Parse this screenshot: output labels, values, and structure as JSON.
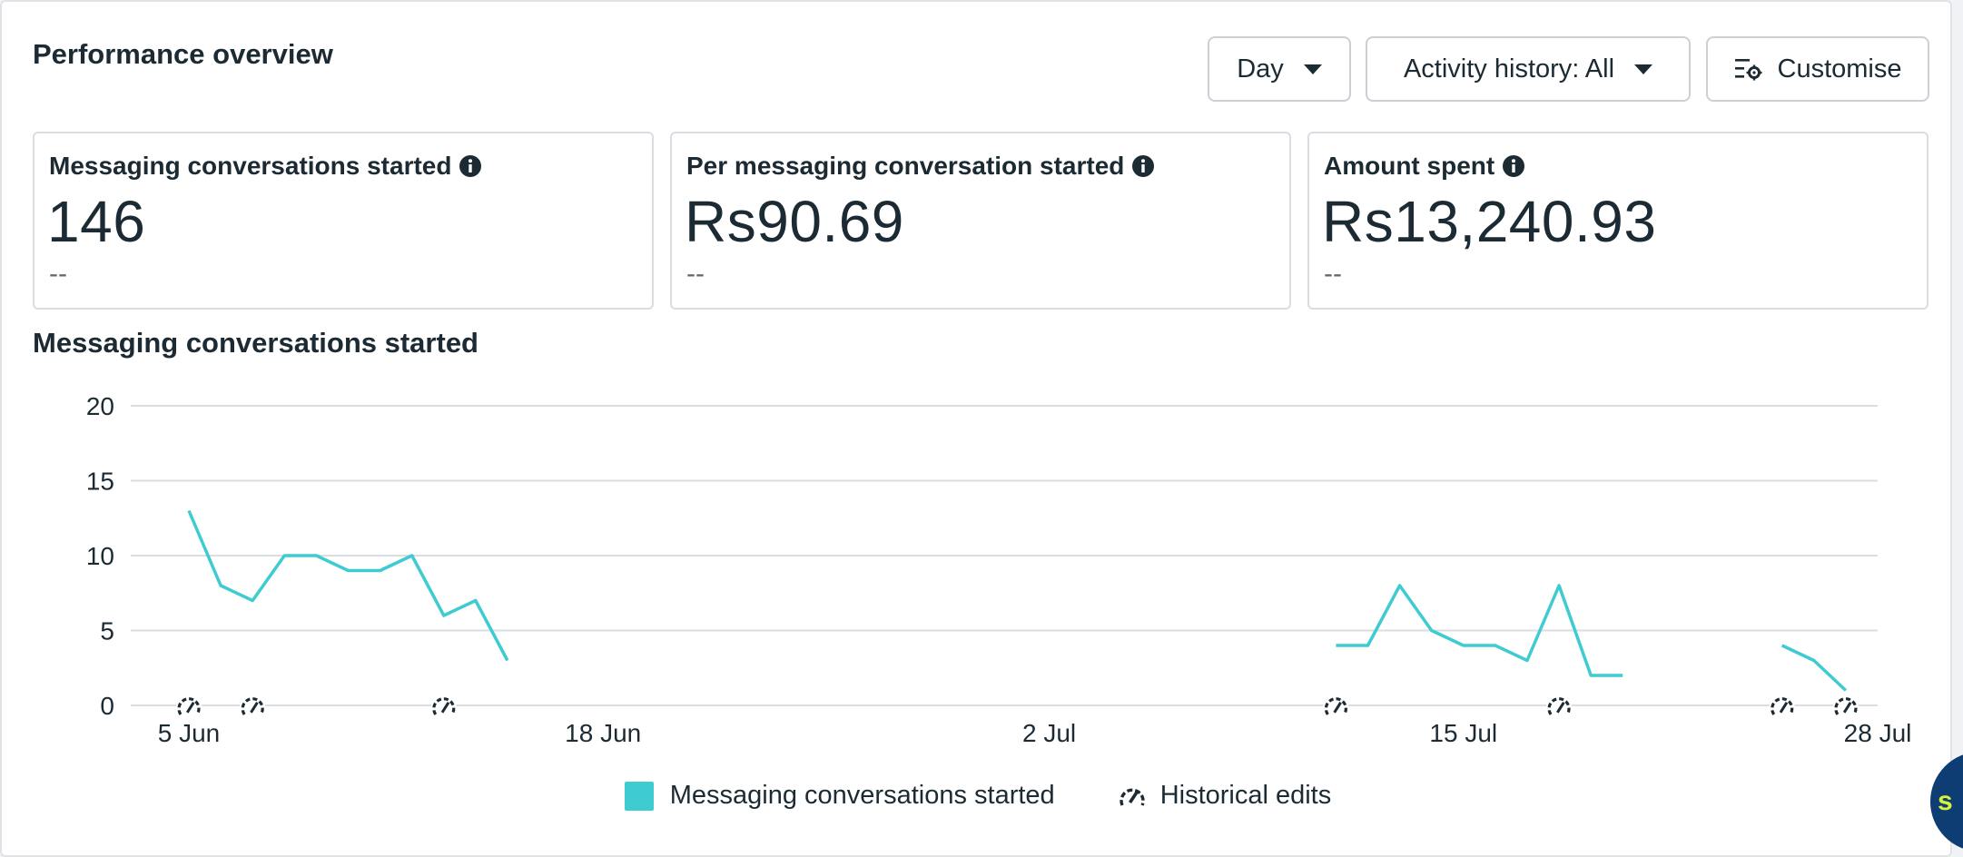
{
  "header": {
    "title": "Performance overview",
    "day_label": "Day",
    "activity_label": "Activity history: All",
    "customise_label": "Customise"
  },
  "kpis": [
    {
      "label": "Messaging conversations started",
      "value": "146",
      "compare": "--"
    },
    {
      "label": "Per messaging conversation started",
      "value": "Rs90.69",
      "compare": "--"
    },
    {
      "label": "Amount spent",
      "value": "Rs13,240.93",
      "compare": "--"
    }
  ],
  "chart_title": "Messaging conversations started",
  "colors": {
    "series": "#3ecbd2",
    "grid": "#dadde1",
    "text": "#1c2b33"
  },
  "chart_data": {
    "type": "line",
    "title": "Messaging conversations started",
    "xlabel": "",
    "ylabel": "",
    "ylim": [
      0,
      20
    ],
    "y_ticks": [
      0,
      5,
      10,
      15,
      20
    ],
    "x_range": [
      "2024-06-05",
      "2024-07-28"
    ],
    "x_tick_labels": [
      {
        "date": "2024-06-05",
        "label": "5 Jun"
      },
      {
        "date": "2024-06-18",
        "label": "18 Jun"
      },
      {
        "date": "2024-07-02",
        "label": "2 Jul"
      },
      {
        "date": "2024-07-15",
        "label": "15 Jul"
      },
      {
        "date": "2024-07-28",
        "label": "28 Jul"
      }
    ],
    "grid": true,
    "legend_position": "bottom-center",
    "series": [
      {
        "name": "Messaging conversations started",
        "segments": [
          [
            [
              "2024-06-05",
              13
            ],
            [
              "2024-06-06",
              8
            ],
            [
              "2024-06-07",
              7
            ],
            [
              "2024-06-08",
              10
            ],
            [
              "2024-06-09",
              10
            ],
            [
              "2024-06-10",
              9
            ],
            [
              "2024-06-11",
              9
            ],
            [
              "2024-06-12",
              10
            ],
            [
              "2024-06-13",
              6
            ],
            [
              "2024-06-14",
              7
            ],
            [
              "2024-06-15",
              3
            ]
          ],
          [
            [
              "2024-07-11",
              4
            ],
            [
              "2024-07-12",
              4
            ],
            [
              "2024-07-13",
              8
            ],
            [
              "2024-07-14",
              5
            ],
            [
              "2024-07-15",
              4
            ],
            [
              "2024-07-16",
              4
            ],
            [
              "2024-07-17",
              3
            ],
            [
              "2024-07-18",
              8
            ],
            [
              "2024-07-19",
              2
            ],
            [
              "2024-07-20",
              2
            ]
          ],
          [
            [
              "2024-07-25",
              4
            ],
            [
              "2024-07-26",
              3
            ],
            [
              "2024-07-27",
              1
            ]
          ]
        ]
      }
    ],
    "historical_edits": [
      "2024-06-05",
      "2024-06-07",
      "2024-06-13",
      "2024-07-11",
      "2024-07-18",
      "2024-07-25",
      "2024-07-27"
    ]
  },
  "legend": {
    "series_label": "Messaging conversations started",
    "edits_label": "Historical edits"
  }
}
